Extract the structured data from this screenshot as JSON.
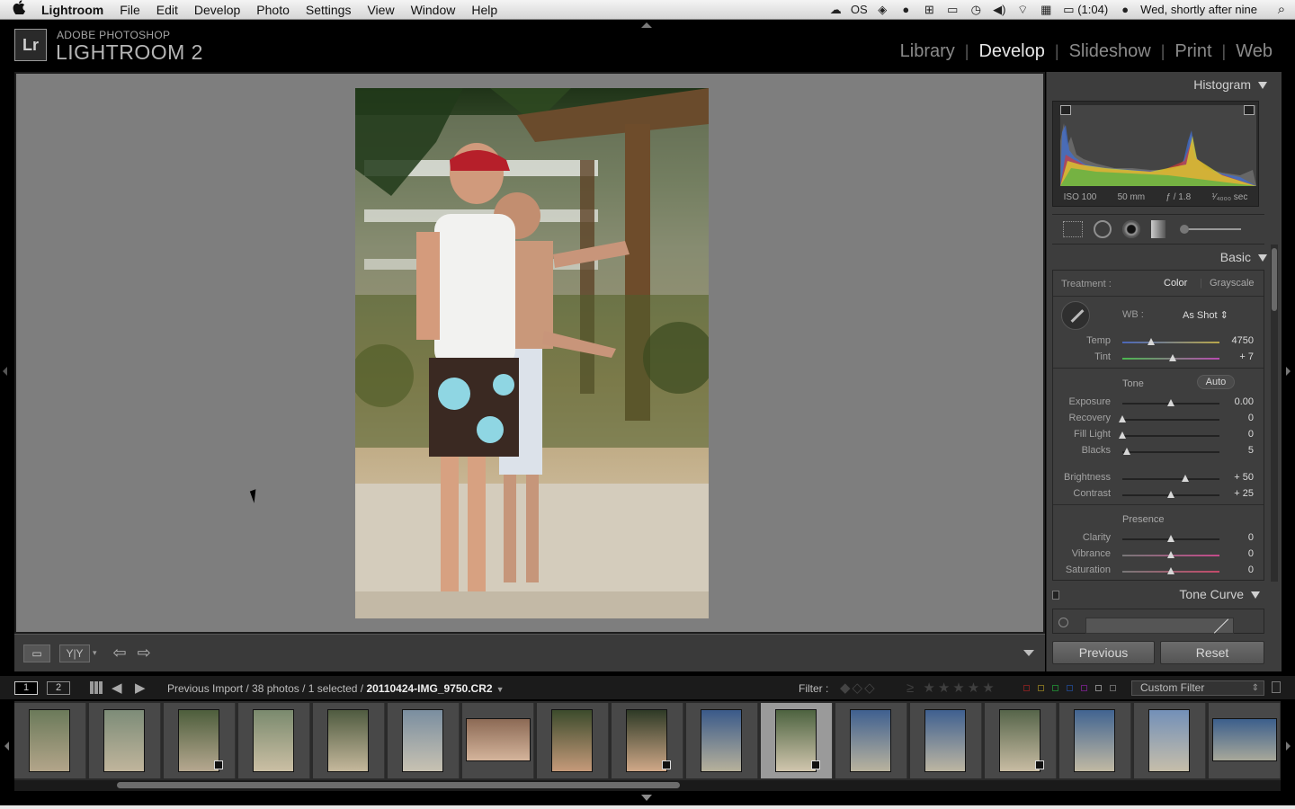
{
  "menubar": {
    "apple": "",
    "items": [
      "Lightroom",
      "File",
      "Edit",
      "Develop",
      "Photo",
      "Settings",
      "View",
      "Window",
      "Help"
    ],
    "battery": "(1:04)",
    "clock": "Wed, shortly after nine"
  },
  "header": {
    "brand_small": "ADOBE PHOTOSHOP",
    "brand_big": "LIGHTROOM 2",
    "logo": "Lr",
    "modules": [
      "Library",
      "Develop",
      "Slideshow",
      "Print",
      "Web"
    ],
    "active_module": "Develop"
  },
  "histogram": {
    "title": "Histogram",
    "iso": "ISO 100",
    "focal": "50 mm",
    "aperture": "ƒ / 1.8",
    "shutter": "¹⁄₄₀₀₀ sec"
  },
  "basic": {
    "title": "Basic",
    "treatment_label": "Treatment :",
    "treatment_color": "Color",
    "treatment_gray": "Grayscale",
    "wb_label": "WB :",
    "wb_value": "As Shot ⇕",
    "tone_label": "Tone",
    "auto_label": "Auto",
    "presence_label": "Presence",
    "sliders": [
      {
        "label": "Temp",
        "value": "4750",
        "pos": 0.3
      },
      {
        "label": "Tint",
        "value": "+ 7",
        "pos": 0.52
      },
      {
        "label": "Exposure",
        "value": "0.00",
        "pos": 0.5
      },
      {
        "label": "Recovery",
        "value": "0",
        "pos": 0.0
      },
      {
        "label": "Fill Light",
        "value": "0",
        "pos": 0.0
      },
      {
        "label": "Blacks",
        "value": "5",
        "pos": 0.05
      },
      {
        "label": "Brightness",
        "value": "+ 50",
        "pos": 0.65
      },
      {
        "label": "Contrast",
        "value": "+ 25",
        "pos": 0.5
      },
      {
        "label": "Clarity",
        "value": "0",
        "pos": 0.5
      },
      {
        "label": "Vibrance",
        "value": "0",
        "pos": 0.5
      },
      {
        "label": "Saturation",
        "value": "0",
        "pos": 0.5
      }
    ]
  },
  "tone_curve": {
    "title": "Tone Curve"
  },
  "buttons": {
    "previous": "Previous",
    "reset": "Reset"
  },
  "filmstrip": {
    "monitor1": "1",
    "monitor2": "2",
    "source": "Previous Import / 38 photos / 1 selected / ",
    "filename": "20110424-IMG_9750.CR2",
    "filter_label": "Filter :",
    "flags": "◆◇◇",
    "stars": "≥ ★★★★★",
    "custom_filter": "Custom Filter",
    "selected_index": 10,
    "thumbs": [
      {
        "c1": "#6b7a5a",
        "c2": "#b3a58a",
        "badge": false
      },
      {
        "c1": "#7d8c78",
        "c2": "#c0b59c",
        "badge": false
      },
      {
        "c1": "#4d5e3c",
        "c2": "#b6a890",
        "badge": true
      },
      {
        "c1": "#7a8a6e",
        "c2": "#cbbfa4",
        "badge": false
      },
      {
        "c1": "#4f5b40",
        "c2": "#c5b89c",
        "badge": false
      },
      {
        "c1": "#7a8ea0",
        "c2": "#c8c2b2",
        "badge": false
      },
      {
        "c1": "#8c6a55",
        "c2": "#d4b49b",
        "badge": false,
        "wide": true
      },
      {
        "c1": "#3c4b2c",
        "c2": "#c59a7a",
        "badge": false
      },
      {
        "c1": "#2e3a26",
        "c2": "#d0a888",
        "badge": true
      },
      {
        "c1": "#3a5a8a",
        "c2": "#b7b19b",
        "badge": false
      },
      {
        "c1": "#4d6340",
        "c2": "#d1c6ae",
        "badge": true
      },
      {
        "c1": "#3f6090",
        "c2": "#b9b39e",
        "badge": false
      },
      {
        "c1": "#3f6090",
        "c2": "#bdb6a2",
        "badge": false
      },
      {
        "c1": "#56654a",
        "c2": "#c8bca3",
        "badge": true
      },
      {
        "c1": "#416491",
        "c2": "#c1b9a3",
        "badge": false
      },
      {
        "c1": "#7390b8",
        "c2": "#c6beaa",
        "badge": false
      },
      {
        "c1": "#3c5f8c",
        "c2": "#a8a89a",
        "badge": false,
        "wide": true
      }
    ]
  }
}
